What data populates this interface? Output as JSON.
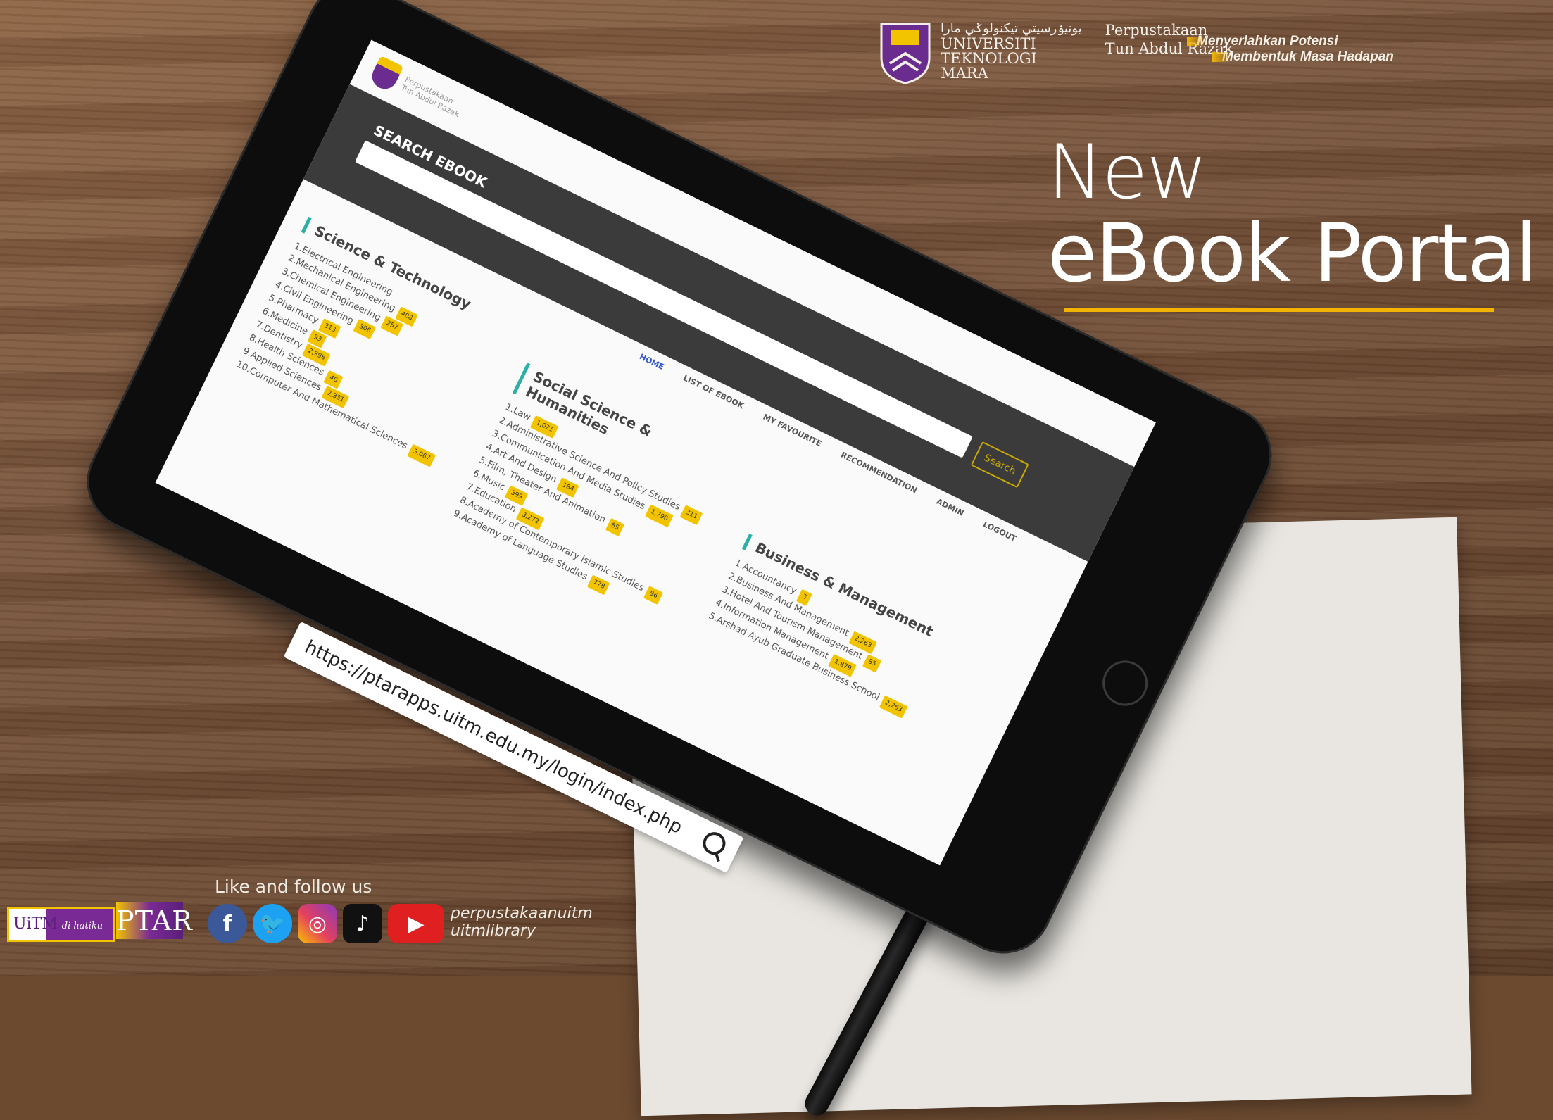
{
  "branding": {
    "university_jawi": "يونيۏرسيتي تيكنولوݢي مارا",
    "university_lines": [
      "UNIVERSITI",
      "TEKNOLOGI",
      "MARA"
    ],
    "library_lines": [
      "Perpustakaan",
      "Tun Abdul Razak"
    ],
    "tagline_lines": [
      "Menyerlahkan Potensi",
      "Membentuk Masa Hadapan"
    ],
    "accent_color": "#f2b400"
  },
  "headline": {
    "line1": "New",
    "line2": "eBook Portal"
  },
  "tablet_screen": {
    "search_title": "SEARCH EBOOK",
    "search_button": "Search",
    "nav": [
      "HOME",
      "LIST OF EBOOK",
      "MY FAVOURITE",
      "RECOMMENDATION",
      "ADMIN",
      "LOGOUT"
    ],
    "categories": [
      {
        "title": "Science & Technology",
        "items": [
          {
            "label": "1.Electrical Engineering",
            "count": ""
          },
          {
            "label": "2.Mechanical Engineering",
            "count": "408"
          },
          {
            "label": "3.Chemical Engineering",
            "count": "257"
          },
          {
            "label": "4.Civil Engineering",
            "count": "306"
          },
          {
            "label": "5.Pharmacy",
            "count": "313"
          },
          {
            "label": "6.Medicine",
            "count": "93"
          },
          {
            "label": "7.Dentistry",
            "count": "2,998"
          },
          {
            "label": "8.Health Sciences",
            "count": "40"
          },
          {
            "label": "9.Applied Sciences",
            "count": "2,331"
          },
          {
            "label": "10.Computer And Mathematical Sciences",
            "count": "3,067"
          }
        ]
      },
      {
        "title": "Social Science & Humanities",
        "items": [
          {
            "label": "1.Law",
            "count": "1,021"
          },
          {
            "label": "2.Administrative Science And Policy Studies",
            "count": "311"
          },
          {
            "label": "3.Communication And Media Studies",
            "count": "1,790"
          },
          {
            "label": "4.Art And Design",
            "count": "184"
          },
          {
            "label": "5.Film, Theater And Animation",
            "count": "85"
          },
          {
            "label": "6.Music",
            "count": "399"
          },
          {
            "label": "7.Education",
            "count": "3,272"
          },
          {
            "label": "8.Academy of Contemporary Islamic Studies",
            "count": "96"
          },
          {
            "label": "9.Academy of Language Studies",
            "count": "778"
          }
        ]
      },
      {
        "title": "Business & Management",
        "items": [
          {
            "label": "1.Accountancy",
            "count": "3"
          },
          {
            "label": "2.Business And Management",
            "count": "2,263"
          },
          {
            "label": "3.Hotel And Tourism Management",
            "count": "85"
          },
          {
            "label": "4.Information Management",
            "count": "1,879"
          },
          {
            "label": "5.Arshad Ayub Graduate Business School",
            "count": "2,263"
          }
        ]
      }
    ],
    "url": "https://ptarapps.uitm.edu.my/login/index.php"
  },
  "footer": {
    "follow_text": "Like and follow us",
    "social_icons": [
      "facebook-icon",
      "twitter-icon",
      "instagram-icon",
      "tiktok-icon",
      "youtube-icon"
    ],
    "handles": [
      "perpustakaanuitm",
      "uitmlibrary"
    ],
    "uitm_badge": "UiTM",
    "uitm_badge_small": "di hatiku",
    "ptar_badge": "PTAR"
  }
}
